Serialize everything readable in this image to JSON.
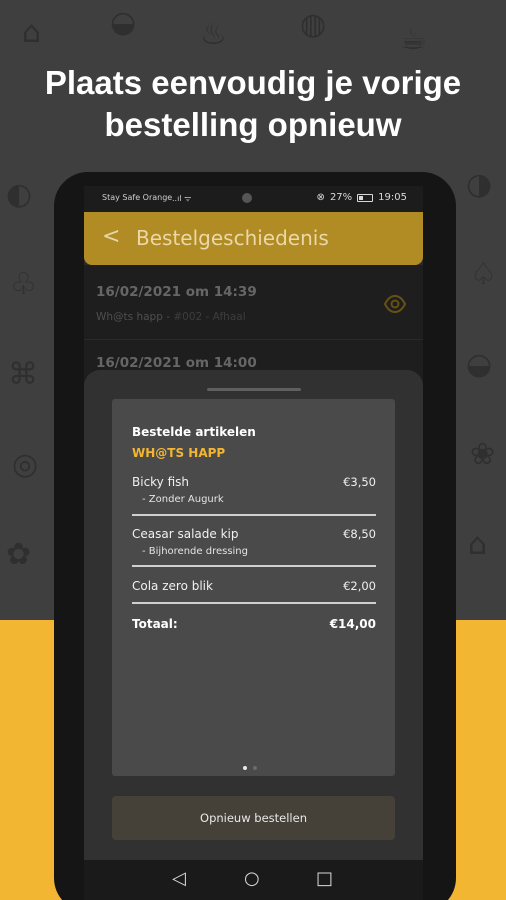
{
  "headline": {
    "line1": "Plaats eenvoudig je vorige",
    "line2": "bestelling opnieuw"
  },
  "status_bar": {
    "carrier": "Stay Safe Orange",
    "signal": "..ıl ᯤ",
    "battery_pct": "27%",
    "time": "19:05"
  },
  "app_bar": {
    "back_glyph": "<",
    "title": "Bestelgeschiedenis"
  },
  "orders": [
    {
      "date": "16/02/2021 om 14:39",
      "restaurant": "Wh@ts happ",
      "separator": " - ",
      "code": "#002 - Afhaal"
    },
    {
      "date": "16/02/2021 om 14:00"
    }
  ],
  "sheet": {
    "heading": "Bestelde artikelen",
    "restaurant": "WH@TS HAPP",
    "items": [
      {
        "name": "Bicky fish",
        "price": "€3,50",
        "modifier": "- Zonder Augurk"
      },
      {
        "name": "Ceasar salade kip",
        "price": "€8,50",
        "modifier": "- Bijhorende dressing"
      },
      {
        "name": "Cola zero blik",
        "price": "€2,00"
      }
    ],
    "total_label": "Totaal:",
    "total_value": "€14,00",
    "reorder_button": "Opnieuw bestellen",
    "pagination": {
      "current": 1,
      "total": 2
    }
  },
  "nav_bar": {
    "back": "◁",
    "home": "○",
    "recents": "□"
  },
  "colors": {
    "accent": "#f2b632",
    "app_bar": "#b18b24",
    "background": "#3f3f3f"
  },
  "icons": [
    "eye-icon",
    "chevron-left-icon"
  ]
}
